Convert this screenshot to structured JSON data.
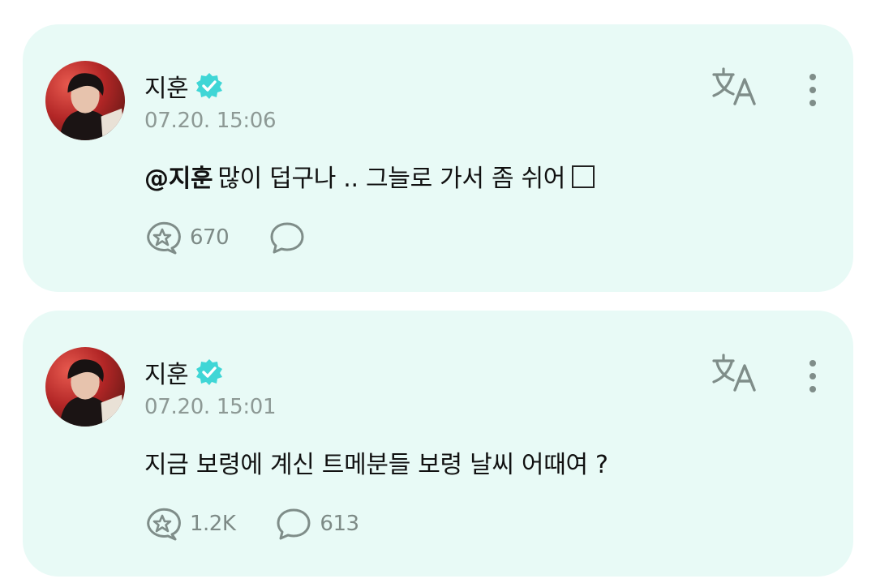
{
  "posts": [
    {
      "author": "지훈",
      "verified": true,
      "timestamp": "07.20. 15:06",
      "mention": "@지훈",
      "text": "많이 덥구나 .. 그늘로 가서 좀 쉬어",
      "has_box_glyph": true,
      "like_count": "670",
      "comment_count": ""
    },
    {
      "author": "지훈",
      "verified": true,
      "timestamp": "07.20. 15:01",
      "mention": "",
      "text": "지금 보령에 계신 트메분들 보령 날씨 어때여 ?",
      "has_box_glyph": false,
      "like_count": "1.2K",
      "comment_count": "613"
    }
  ],
  "icons": {
    "verified": "verified-badge-icon",
    "translate": "translate-icon",
    "more": "more-vertical-icon",
    "like": "star-bubble-icon",
    "comment": "comment-bubble-icon"
  },
  "colors": {
    "card_background": "#e8faf6",
    "verified_badge": "#3fd6d6",
    "icon_muted": "#7f8d89",
    "timestamp": "#8d9995",
    "text": "#111111"
  }
}
